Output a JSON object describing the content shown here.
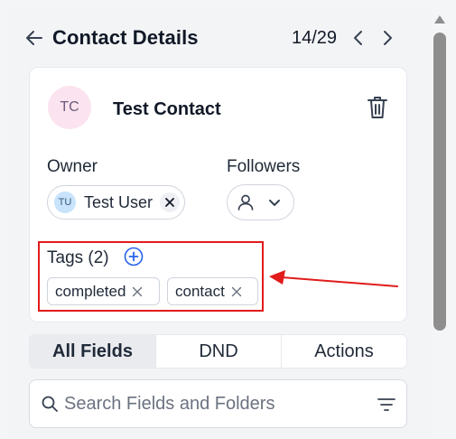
{
  "header": {
    "title": "Contact Details",
    "pager": "14/29"
  },
  "contact": {
    "initials": "TC",
    "name": "Test Contact"
  },
  "owner": {
    "label": "Owner",
    "initials": "TU",
    "name": "Test User"
  },
  "followers": {
    "label": "Followers"
  },
  "tags": {
    "label": "Tags (2)",
    "items": [
      "completed",
      "contact"
    ]
  },
  "tabs": [
    "All Fields",
    "DND",
    "Actions"
  ],
  "search": {
    "placeholder": "Search Fields and Folders"
  },
  "colors": {
    "annotation": "#e21b1b",
    "accent": "#2563eb"
  }
}
